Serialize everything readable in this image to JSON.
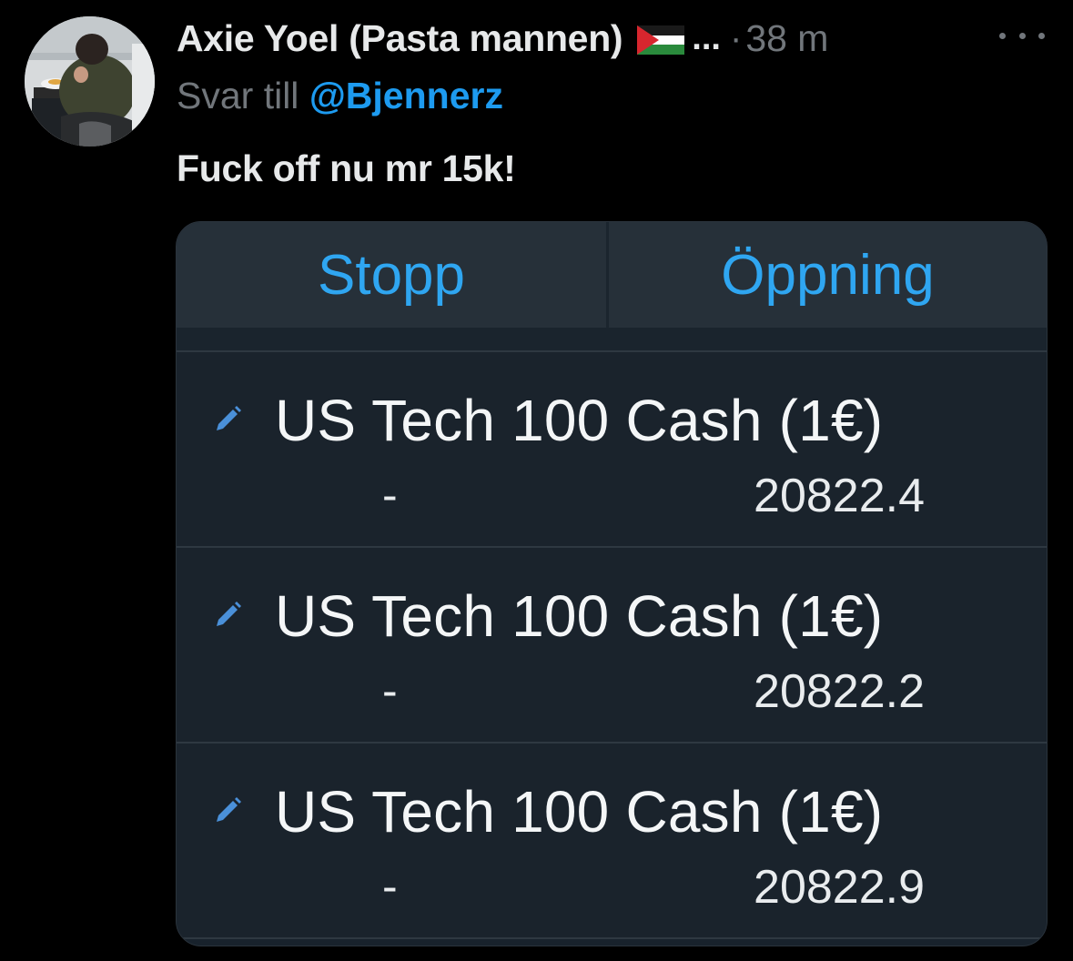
{
  "tweet": {
    "author_name": "Axie Yoel (Pasta mannen)",
    "flag_icon": "palestine-flag-icon",
    "truncation": "...",
    "separator": "·",
    "time": "38 m",
    "more_icon": "more-horizontal-icon",
    "reply_prefix": "Svar till",
    "reply_handle": "@Bjennerz",
    "text": "Fuck off nu mr 15k!"
  },
  "screenshot": {
    "tabs": [
      {
        "label": "Stopp"
      },
      {
        "label": "Öppning"
      }
    ],
    "rows": [
      {
        "instrument": "US Tech 100 Cash (1€)",
        "stop": "-",
        "open": "20822.4",
        "icon": "pencil-icon"
      },
      {
        "instrument": "US Tech 100 Cash (1€)",
        "stop": "-",
        "open": "20822.2",
        "icon": "pencil-icon"
      },
      {
        "instrument": "US Tech 100 Cash (1€)",
        "stop": "-",
        "open": "20822.9",
        "icon": "pencil-icon"
      }
    ]
  },
  "colors": {
    "background": "#000000",
    "primary_text": "#e7e9ea",
    "secondary_text": "#71767b",
    "link": "#1d9bf0",
    "tab_text": "#2fa6f1",
    "panel": "#1a232c",
    "edit_icon": "#4a90d9"
  }
}
